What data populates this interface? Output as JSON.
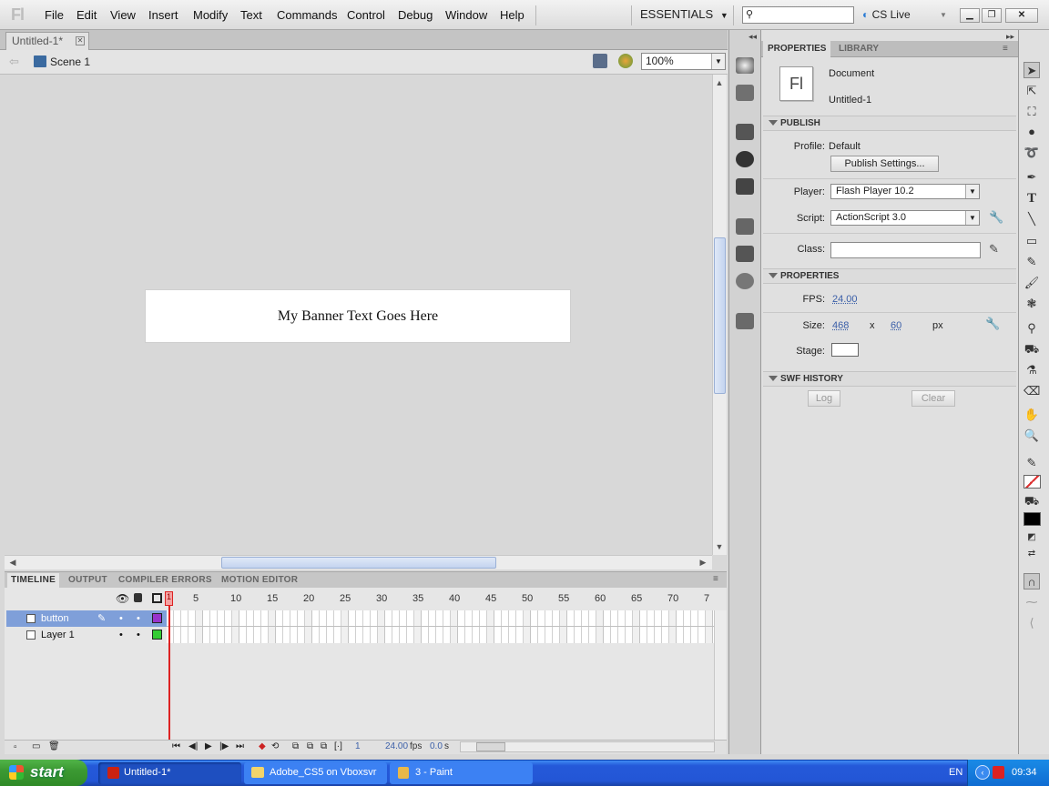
{
  "app": {
    "logo": "Fl"
  },
  "menu": [
    "File",
    "Edit",
    "View",
    "Insert",
    "Modify",
    "Text",
    "Commands",
    "Control",
    "Debug",
    "Window",
    "Help"
  ],
  "workspace": "ESSENTIALS",
  "cslive": "CS Live",
  "document_tab": "Untitled-1*",
  "scene": "Scene 1",
  "zoom": "100%",
  "stage": {
    "text": "My Banner Text Goes Here"
  },
  "panel_tabs": [
    "TIMELINE",
    "OUTPUT",
    "COMPILER ERRORS",
    "MOTION EDITOR"
  ],
  "timeline": {
    "frame_numbers": [
      "5",
      "10",
      "15",
      "20",
      "25",
      "30",
      "35",
      "40",
      "45",
      "50",
      "55",
      "60",
      "65",
      "70",
      "7"
    ],
    "current_frame_marker": "1",
    "layers": [
      "button",
      "Layer 1"
    ],
    "footer": {
      "frame": "1",
      "fps": "24.00",
      "fps_unit": "fps",
      "time": "0.0",
      "time_unit": "s"
    }
  },
  "properties_panel": {
    "tabs": [
      "PROPERTIES",
      "LIBRARY"
    ],
    "doc_icon": "Fl",
    "doc_type": "Document",
    "doc_name": "Untitled-1",
    "publish": {
      "header": "PUBLISH",
      "profile_label": "Profile:",
      "profile_value": "Default",
      "settings_button": "Publish Settings...",
      "player_label": "Player:",
      "player_value": "Flash Player 10.2",
      "script_label": "Script:",
      "script_value": "ActionScript 3.0",
      "class_label": "Class:",
      "class_value": ""
    },
    "properties": {
      "header": "PROPERTIES",
      "fps_label": "FPS:",
      "fps_value": "24.00",
      "size_label": "Size:",
      "width": "468",
      "x": "x",
      "height": "60",
      "unit": "px",
      "stage_label": "Stage:",
      "stage_color": "#ffffff"
    },
    "swf_history": {
      "header": "SWF HISTORY",
      "log_button": "Log",
      "clear_button": "Clear"
    }
  },
  "taskbar": {
    "start": "start",
    "tasks": [
      "Untitled-1*",
      "Adobe_CS5 on Vboxsvr",
      "3 - Paint"
    ],
    "language": "EN",
    "clock": "09:34"
  },
  "colors": {
    "accent_selected_layer": "#7f9fd9",
    "layer_button_color": "#9933cc",
    "layer1_color": "#33cc33",
    "playhead": "#dd2222"
  }
}
